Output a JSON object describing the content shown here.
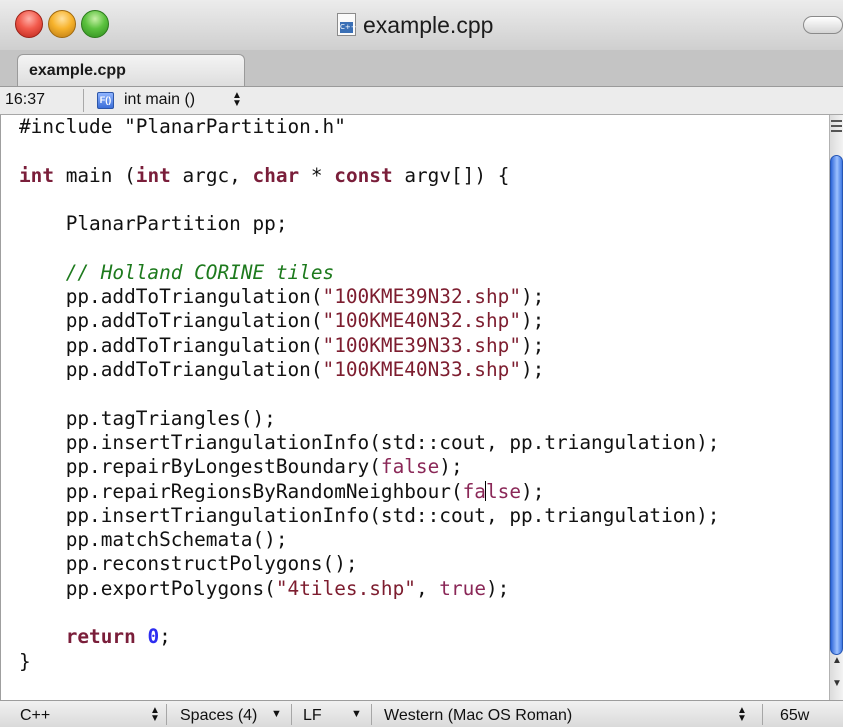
{
  "window": {
    "title": "example.cpp",
    "file_icon_label": "C++"
  },
  "tabs": [
    {
      "label": "example.cpp",
      "active": true
    }
  ],
  "navigation": {
    "cursor_position": "16:37",
    "function_icon": "function-badge-icon",
    "function_badge": "F()",
    "function_name": "int main ()"
  },
  "editor": {
    "language": "C++",
    "lines": [
      {
        "n": 1,
        "tokens": [
          {
            "t": "#include \"PlanarPartition.h\"",
            "c": "plain"
          }
        ]
      },
      {
        "n": 2,
        "tokens": []
      },
      {
        "n": 3,
        "tokens": [
          {
            "t": "int",
            "c": "kw"
          },
          {
            "t": " main (",
            "c": "plain"
          },
          {
            "t": "int",
            "c": "kw"
          },
          {
            "t": " argc, ",
            "c": "plain"
          },
          {
            "t": "char",
            "c": "kw"
          },
          {
            "t": " * ",
            "c": "plain"
          },
          {
            "t": "const",
            "c": "kw"
          },
          {
            "t": " argv[]) {",
            "c": "plain"
          }
        ]
      },
      {
        "n": 4,
        "tokens": []
      },
      {
        "n": 5,
        "tokens": [
          {
            "t": "    PlanarPartition pp;",
            "c": "plain"
          }
        ]
      },
      {
        "n": 6,
        "tokens": []
      },
      {
        "n": 7,
        "tokens": [
          {
            "t": "    ",
            "c": "plain"
          },
          {
            "t": "// Holland CORINE tiles",
            "c": "cmt"
          }
        ]
      },
      {
        "n": 8,
        "tokens": [
          {
            "t": "    pp.addToTriangulation(",
            "c": "plain"
          },
          {
            "t": "\"100KME39N32.shp\"",
            "c": "str"
          },
          {
            "t": ");",
            "c": "plain"
          }
        ]
      },
      {
        "n": 9,
        "tokens": [
          {
            "t": "    pp.addToTriangulation(",
            "c": "plain"
          },
          {
            "t": "\"100KME40N32.shp\"",
            "c": "str"
          },
          {
            "t": ");",
            "c": "plain"
          }
        ]
      },
      {
        "n": 10,
        "tokens": [
          {
            "t": "    pp.addToTriangulation(",
            "c": "plain"
          },
          {
            "t": "\"100KME39N33.shp\"",
            "c": "str"
          },
          {
            "t": ");",
            "c": "plain"
          }
        ]
      },
      {
        "n": 11,
        "tokens": [
          {
            "t": "    pp.addToTriangulation(",
            "c": "plain"
          },
          {
            "t": "\"100KME40N33.shp\"",
            "c": "str"
          },
          {
            "t": ");",
            "c": "plain"
          }
        ]
      },
      {
        "n": 12,
        "tokens": []
      },
      {
        "n": 13,
        "tokens": [
          {
            "t": "    pp.tagTriangles();",
            "c": "plain"
          }
        ]
      },
      {
        "n": 14,
        "tokens": [
          {
            "t": "    pp.insertTriangulationInfo(std::cout, pp.triangulation);",
            "c": "plain"
          }
        ]
      },
      {
        "n": 15,
        "tokens": [
          {
            "t": "    pp.repairByLongestBoundary(",
            "c": "plain"
          },
          {
            "t": "false",
            "c": "lit"
          },
          {
            "t": ");",
            "c": "plain"
          }
        ]
      },
      {
        "n": 16,
        "tokens": [
          {
            "t": "    pp.repairRegionsByRandomNeighbour(",
            "c": "plain"
          },
          {
            "t": "fa",
            "c": "lit"
          },
          {
            "t": "",
            "c": "caret"
          },
          {
            "t": "lse",
            "c": "lit"
          },
          {
            "t": ");",
            "c": "plain"
          }
        ]
      },
      {
        "n": 17,
        "tokens": [
          {
            "t": "    pp.insertTriangulationInfo(std::cout, pp.triangulation);",
            "c": "plain"
          }
        ]
      },
      {
        "n": 18,
        "tokens": [
          {
            "t": "    pp.matchSchemata();",
            "c": "plain"
          }
        ]
      },
      {
        "n": 19,
        "tokens": [
          {
            "t": "    pp.reconstructPolygons();",
            "c": "plain"
          }
        ]
      },
      {
        "n": 20,
        "tokens": [
          {
            "t": "    pp.exportPolygons(",
            "c": "plain"
          },
          {
            "t": "\"4tiles.shp\"",
            "c": "str"
          },
          {
            "t": ", ",
            "c": "plain"
          },
          {
            "t": "true",
            "c": "lit"
          },
          {
            "t": ");",
            "c": "plain"
          }
        ]
      },
      {
        "n": 21,
        "tokens": []
      },
      {
        "n": 22,
        "tokens": [
          {
            "t": "    ",
            "c": "plain"
          },
          {
            "t": "return",
            "c": "kw"
          },
          {
            "t": " ",
            "c": "plain"
          },
          {
            "t": "0",
            "c": "num"
          },
          {
            "t": ";",
            "c": "plain"
          }
        ]
      },
      {
        "n": 23,
        "tokens": [
          {
            "t": "}",
            "c": "plain"
          }
        ]
      }
    ]
  },
  "statusbar": {
    "language": "C++",
    "indentation": "Spaces (4)",
    "line_endings": "LF",
    "encoding": "Western (Mac OS Roman)",
    "word_count": "65w"
  },
  "colors": {
    "keyword": "#7a1e3a",
    "string": "#7d1d2f",
    "literal": "#8a2757",
    "number": "#2d2df0",
    "comment": "#1d7a1d",
    "scroll_thumb": "#3f78e2"
  }
}
